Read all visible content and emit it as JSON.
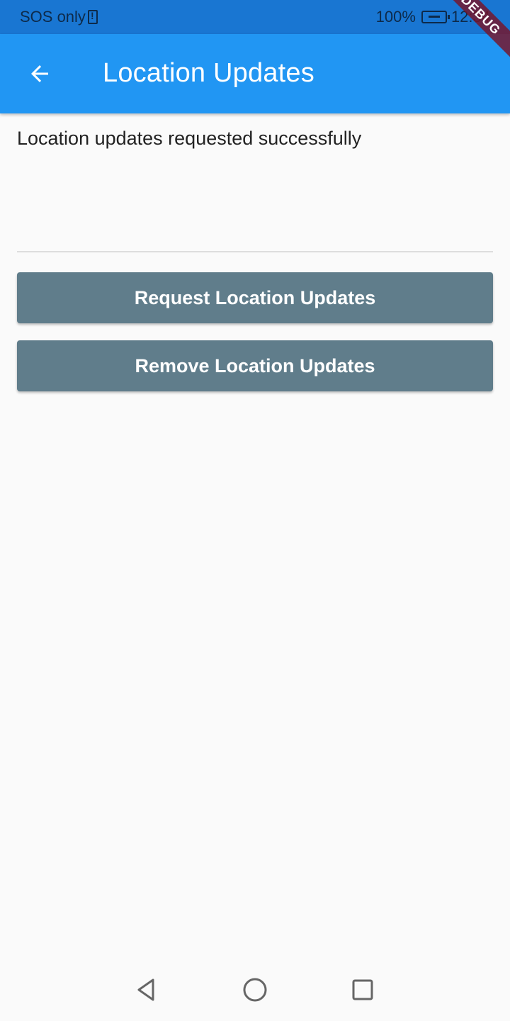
{
  "status_bar": {
    "carrier": "SOS only",
    "battery": "100%",
    "time": "12:34"
  },
  "app_bar": {
    "title": "Location Updates",
    "back_icon": "arrow-back-icon"
  },
  "debug_banner": "DEBUG",
  "main": {
    "message": "Location updates requested successfully",
    "request_button_label": "Request Location Updates",
    "remove_button_label": "Remove Location Updates"
  },
  "nav_bar": {
    "icons": [
      "nav-back-icon",
      "nav-home-icon",
      "nav-recents-icon"
    ]
  },
  "colors": {
    "app_bar": "#2196f3",
    "status_bar": "#1976d2",
    "button": "#607d8b",
    "background": "#fafafa"
  }
}
